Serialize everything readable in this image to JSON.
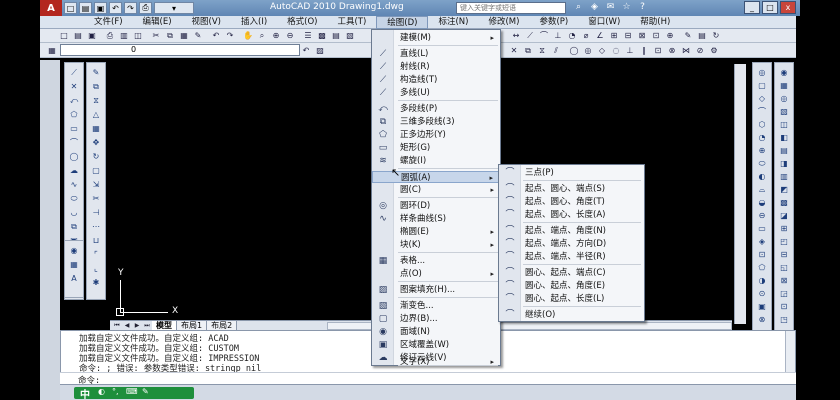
{
  "window": {
    "app_logo": "A",
    "title": "AutoCAD 2010    Drawing1.dwg",
    "search_placeholder": "键入关键字或短语",
    "controls": [
      "_",
      "□",
      "x"
    ]
  },
  "menubar": {
    "items": [
      "文件(F)",
      "编辑(E)",
      "视图(V)",
      "插入(I)",
      "格式(O)",
      "工具(T)",
      "绘图(D)",
      "标注(N)",
      "修改(M)",
      "参数(P)",
      "窗口(W)",
      "帮助(H)"
    ],
    "active_index": 6
  },
  "layer": {
    "value": "0"
  },
  "draw_menu": {
    "items": [
      {
        "label": "建模(M)",
        "icon": "",
        "arrow": "▸"
      },
      {
        "label": "直线(L)",
        "icon": "⟋",
        "arrow": ""
      },
      {
        "label": "射线(R)",
        "icon": "⟋",
        "arrow": ""
      },
      {
        "label": "构造线(T)",
        "icon": "⟋",
        "arrow": ""
      },
      {
        "label": "多线(U)",
        "icon": "⟋",
        "arrow": ""
      },
      {
        "label": "多段线(P)",
        "icon": "⤺",
        "arrow": ""
      },
      {
        "label": "三维多段线(3)",
        "icon": "⧉",
        "arrow": ""
      },
      {
        "label": "正多边形(Y)",
        "icon": "⬠",
        "arrow": ""
      },
      {
        "label": "矩形(G)",
        "icon": "▭",
        "arrow": ""
      },
      {
        "label": "螺旋(I)",
        "icon": "≋",
        "arrow": ""
      },
      {
        "label": "圆弧(A)",
        "icon": "",
        "arrow": "▸"
      },
      {
        "label": "圆(C)",
        "icon": "",
        "arrow": "▸"
      },
      {
        "label": "圆环(D)",
        "icon": "◎",
        "arrow": ""
      },
      {
        "label": "样条曲线(S)",
        "icon": "∿",
        "arrow": ""
      },
      {
        "label": "椭圆(E)",
        "icon": "",
        "arrow": "▸"
      },
      {
        "label": "块(K)",
        "icon": "",
        "arrow": "▸"
      },
      {
        "label": "表格...",
        "icon": "▦",
        "arrow": ""
      },
      {
        "label": "点(O)",
        "icon": "",
        "arrow": "▸"
      },
      {
        "label": "图案填充(H)...",
        "icon": "▨",
        "arrow": ""
      },
      {
        "label": "渐变色...",
        "icon": "▧",
        "arrow": ""
      },
      {
        "label": "边界(B)...",
        "icon": "▢",
        "arrow": ""
      },
      {
        "label": "面域(N)",
        "icon": "◉",
        "arrow": ""
      },
      {
        "label": "区域覆盖(W)",
        "icon": "▣",
        "arrow": ""
      },
      {
        "label": "修订云线(V)",
        "icon": "☁",
        "arrow": ""
      },
      {
        "label": "文字(X)",
        "icon": "",
        "arrow": "▸"
      }
    ],
    "highlighted_index": 10
  },
  "arc_submenu": {
    "items": [
      {
        "label": "三点(P)",
        "icon": "⌒"
      },
      {
        "label": "起点、圆心、端点(S)",
        "icon": "⌒"
      },
      {
        "label": "起点、圆心、角度(T)",
        "icon": "⌒"
      },
      {
        "label": "起点、圆心、长度(A)",
        "icon": "⌒"
      },
      {
        "label": "起点、端点、角度(N)",
        "icon": "⌒"
      },
      {
        "label": "起点、端点、方向(D)",
        "icon": "⌒"
      },
      {
        "label": "起点、端点、半径(R)",
        "icon": "⌒"
      },
      {
        "label": "圆心、起点、端点(C)",
        "icon": "⌒"
      },
      {
        "label": "圆心、起点、角度(E)",
        "icon": "⌒"
      },
      {
        "label": "圆心、起点、长度(L)",
        "icon": "⌒"
      },
      {
        "label": "继续(O)",
        "icon": "⌒"
      }
    ]
  },
  "ucs": {
    "x_label": "X",
    "y_label": "Y"
  },
  "tabs": {
    "items": [
      "模型",
      "布局1",
      "布局2"
    ],
    "active_index": 0,
    "nav": [
      "⏮",
      "◀",
      "▶",
      "⏭"
    ]
  },
  "command": {
    "lines": [
      "加载自定义文件成功。自定义组: ACAD",
      "加载自定义文件成功。自定义组: CUSTOM",
      "加载自定义文件成功。自定义组: IMPRESSION",
      "命令: ; 错误: 参数类型错误: stringp nil"
    ],
    "prompt": "命令:"
  },
  "statusbar": {
    "ime": "中",
    "icons": [
      "◐",
      "°,",
      "⌨",
      "✎"
    ]
  }
}
